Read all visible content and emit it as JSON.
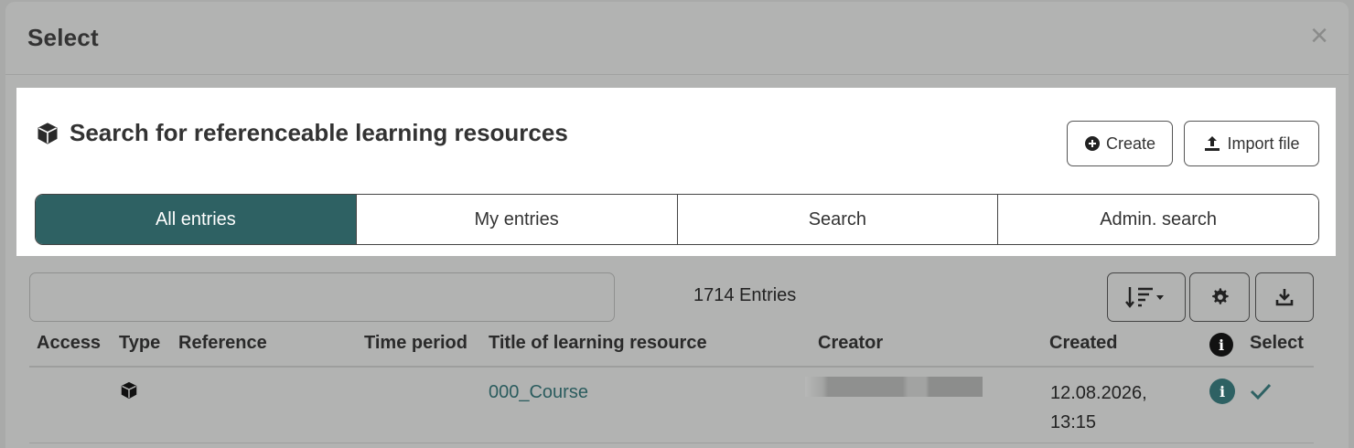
{
  "modal": {
    "title": "Select",
    "close_symbol": "×"
  },
  "panel": {
    "title": "Search for referenceable learning resources",
    "title_icon": "cube-icon",
    "create_label": "Create",
    "import_label": "Import file"
  },
  "tabs": [
    {
      "label": "All entries",
      "active": true
    },
    {
      "label": "My entries",
      "active": false
    },
    {
      "label": "Search",
      "active": false
    },
    {
      "label": "Admin. search",
      "active": false
    }
  ],
  "toolbar": {
    "filter_value": "",
    "entries_count": "1714 Entries"
  },
  "table": {
    "columns": [
      "Access",
      "Type",
      "Reference",
      "Time period",
      "Title of learning resource",
      "Creator",
      "Created",
      "Select"
    ],
    "rows": [
      {
        "access": "",
        "type_icon": "cube-icon",
        "reference": "",
        "time_period": "",
        "title": "000_Course",
        "creator": "",
        "created_date": "12.08.2026,",
        "created_time": "13:15"
      }
    ]
  },
  "colors": {
    "accent": "#2e6163",
    "overlay": "#b2b3b2",
    "link": "#2b5c5e"
  }
}
